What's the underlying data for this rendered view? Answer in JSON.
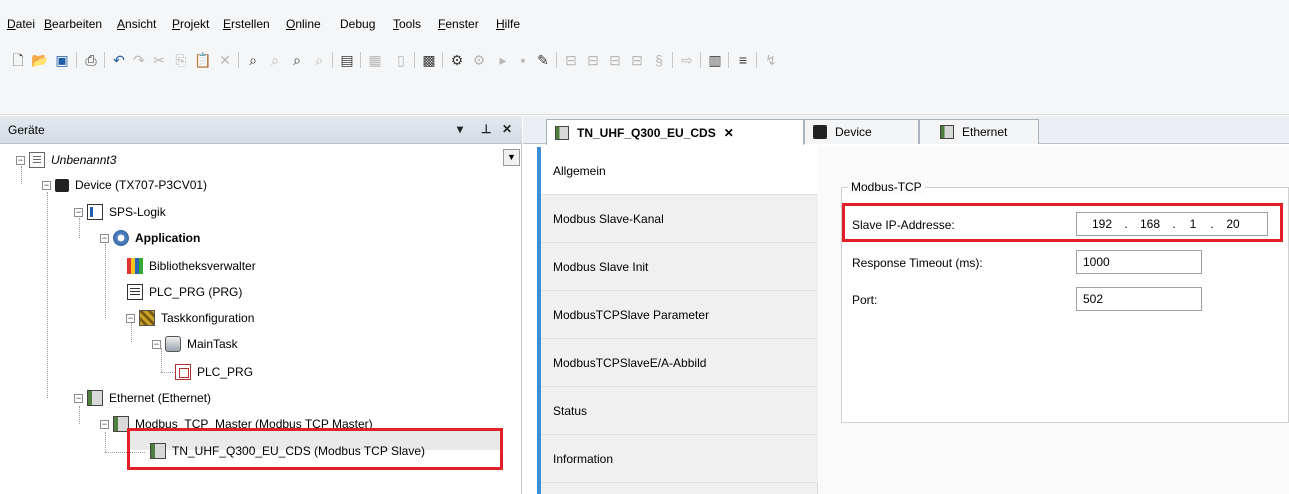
{
  "menu": {
    "items": [
      {
        "pre": "",
        "u": "D",
        "post": "atei"
      },
      {
        "pre": "",
        "u": "B",
        "post": "earbeiten"
      },
      {
        "pre": "",
        "u": "A",
        "post": "nsicht"
      },
      {
        "pre": "",
        "u": "P",
        "post": "rojekt"
      },
      {
        "pre": "",
        "u": "E",
        "post": "rstellen"
      },
      {
        "pre": "",
        "u": "O",
        "post": "nline"
      },
      {
        "pre": "Debu",
        "u": "g",
        "post": ""
      },
      {
        "pre": "",
        "u": "T",
        "post": "ools"
      },
      {
        "pre": "",
        "u": "F",
        "post": "enster"
      },
      {
        "pre": "",
        "u": "H",
        "post": "ilfe"
      }
    ]
  },
  "devices": {
    "title": "Geräte",
    "pin_glyph": "▾  ⊥",
    "close_glyph": "✕",
    "dropdown_glyph": "▼",
    "tree": {
      "project": "Unbenannt3",
      "device": "Device (TX707-P3CV01)",
      "sps_logic": "SPS-Logik",
      "application": "Application",
      "library_manager": "Bibliotheksverwalter",
      "plc_prg": "PLC_PRG (PRG)",
      "task_config": "Taskkonfiguration",
      "main_task": "MainTask",
      "plc_prg_call": "PLC_PRG",
      "ethernet": "Ethernet (Ethernet)",
      "modbus_master": "Modbus_TCP_Master (Modbus TCP Master)",
      "modbus_slave": "TN_UHF_Q300_EU_CDS (Modbus TCP Slave)"
    }
  },
  "editor": {
    "tabs": [
      {
        "label": "TN_UHF_Q300_EU_CDS",
        "close": "✕"
      },
      {
        "label": "Device"
      },
      {
        "label": "Ethernet"
      }
    ],
    "nav": [
      "Allgemein",
      "Modbus Slave-Kanal",
      "Modbus Slave Init",
      "ModbusTCPSlave Parameter",
      "ModbusTCPSlaveE/A-Abbild",
      "Status",
      "Information"
    ],
    "form": {
      "group_title": "Modbus-TCP",
      "ip_label": "Slave IP-Addresse:",
      "ip": [
        "192",
        ".",
        "168",
        ".",
        "1",
        ".",
        "20"
      ],
      "timeout_label": "Response Timeout (ms):",
      "timeout_value": "1000",
      "port_label": "Port:",
      "port_value": "502"
    }
  },
  "colors": {
    "highlight_box": "#e3202a",
    "nav_accent": "#3b8fd6"
  }
}
